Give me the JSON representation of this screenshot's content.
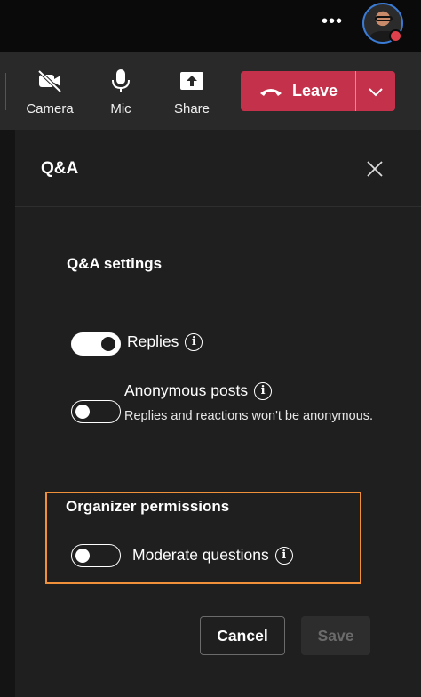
{
  "titlebar": {
    "more_label": "•••"
  },
  "toolbar": {
    "camera_label": "Camera",
    "mic_label": "Mic",
    "share_label": "Share",
    "leave_label": "Leave"
  },
  "panel": {
    "title": "Q&A",
    "settings_title": "Q&A settings",
    "replies_label": "Replies",
    "anonymous_label": "Anonymous posts",
    "anonymous_desc": "Replies and reactions won't be anonymous.",
    "organizer_title": "Organizer permissions",
    "moderate_label": "Moderate questions",
    "info_glyph": "i",
    "cancel_label": "Cancel",
    "save_label": "Save"
  },
  "toggles": {
    "replies": true,
    "anonymous": false,
    "moderate": false
  },
  "colors": {
    "leave_red": "#c4314b",
    "highlight_orange": "#f0903a",
    "panel_bg": "#1f1f1f",
    "toolbar_bg": "#292929",
    "presence_red": "#e0404b"
  },
  "icons": [
    "more-icon",
    "camera-off-icon",
    "mic-icon",
    "share-icon",
    "phone-hangup-icon",
    "chevron-down-icon",
    "close-icon",
    "info-icon"
  ]
}
